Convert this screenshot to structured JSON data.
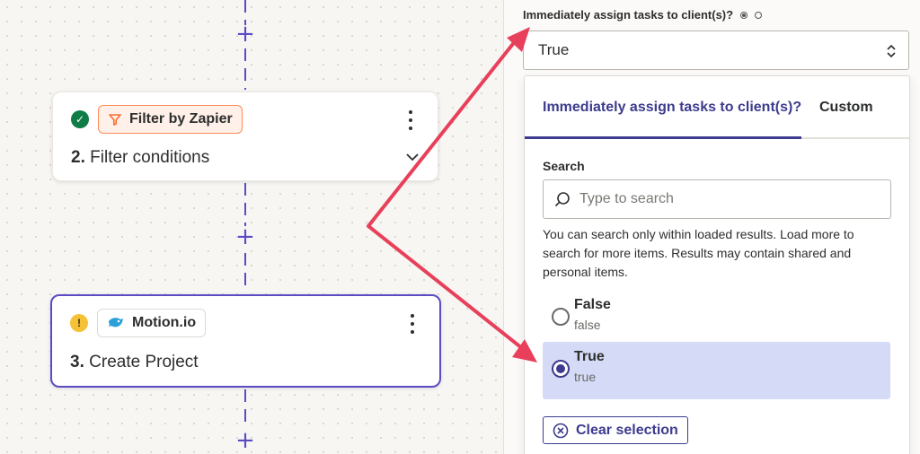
{
  "canvas": {
    "add_step_symbol": "+",
    "steps": [
      {
        "status": "ok",
        "app_name": "Filter by Zapier",
        "number": "2.",
        "title": "Filter conditions"
      },
      {
        "status": "warning",
        "app_name": "Motion.io",
        "number": "3.",
        "title": "Create Project"
      }
    ]
  },
  "panel": {
    "field_label": "Immediately assign tasks to client(s)?",
    "selected_value": "True",
    "dropdown": {
      "tabs": [
        {
          "label": "Immediately assign tasks to client(s)?",
          "active": true
        },
        {
          "label": "Custom",
          "active": false
        }
      ],
      "search_label": "Search",
      "search_placeholder": "Type to search",
      "helper_text": "You can search only within loaded results. Load more to search for more items. Results may contain shared and personal items.",
      "options": [
        {
          "label": "False",
          "value": "false",
          "selected": false
        },
        {
          "label": "True",
          "value": "true",
          "selected": true
        }
      ],
      "clear_label": "Clear selection"
    }
  },
  "colors": {
    "accent": "#3d3b8e",
    "connector": "#5b4cc4",
    "annotation_arrow": "#e8405a",
    "selected_option_bg": "#d5dbf7",
    "filter_chip_border": "#ff8a55",
    "success": "#0f7b45",
    "warning": "#f5c237"
  }
}
